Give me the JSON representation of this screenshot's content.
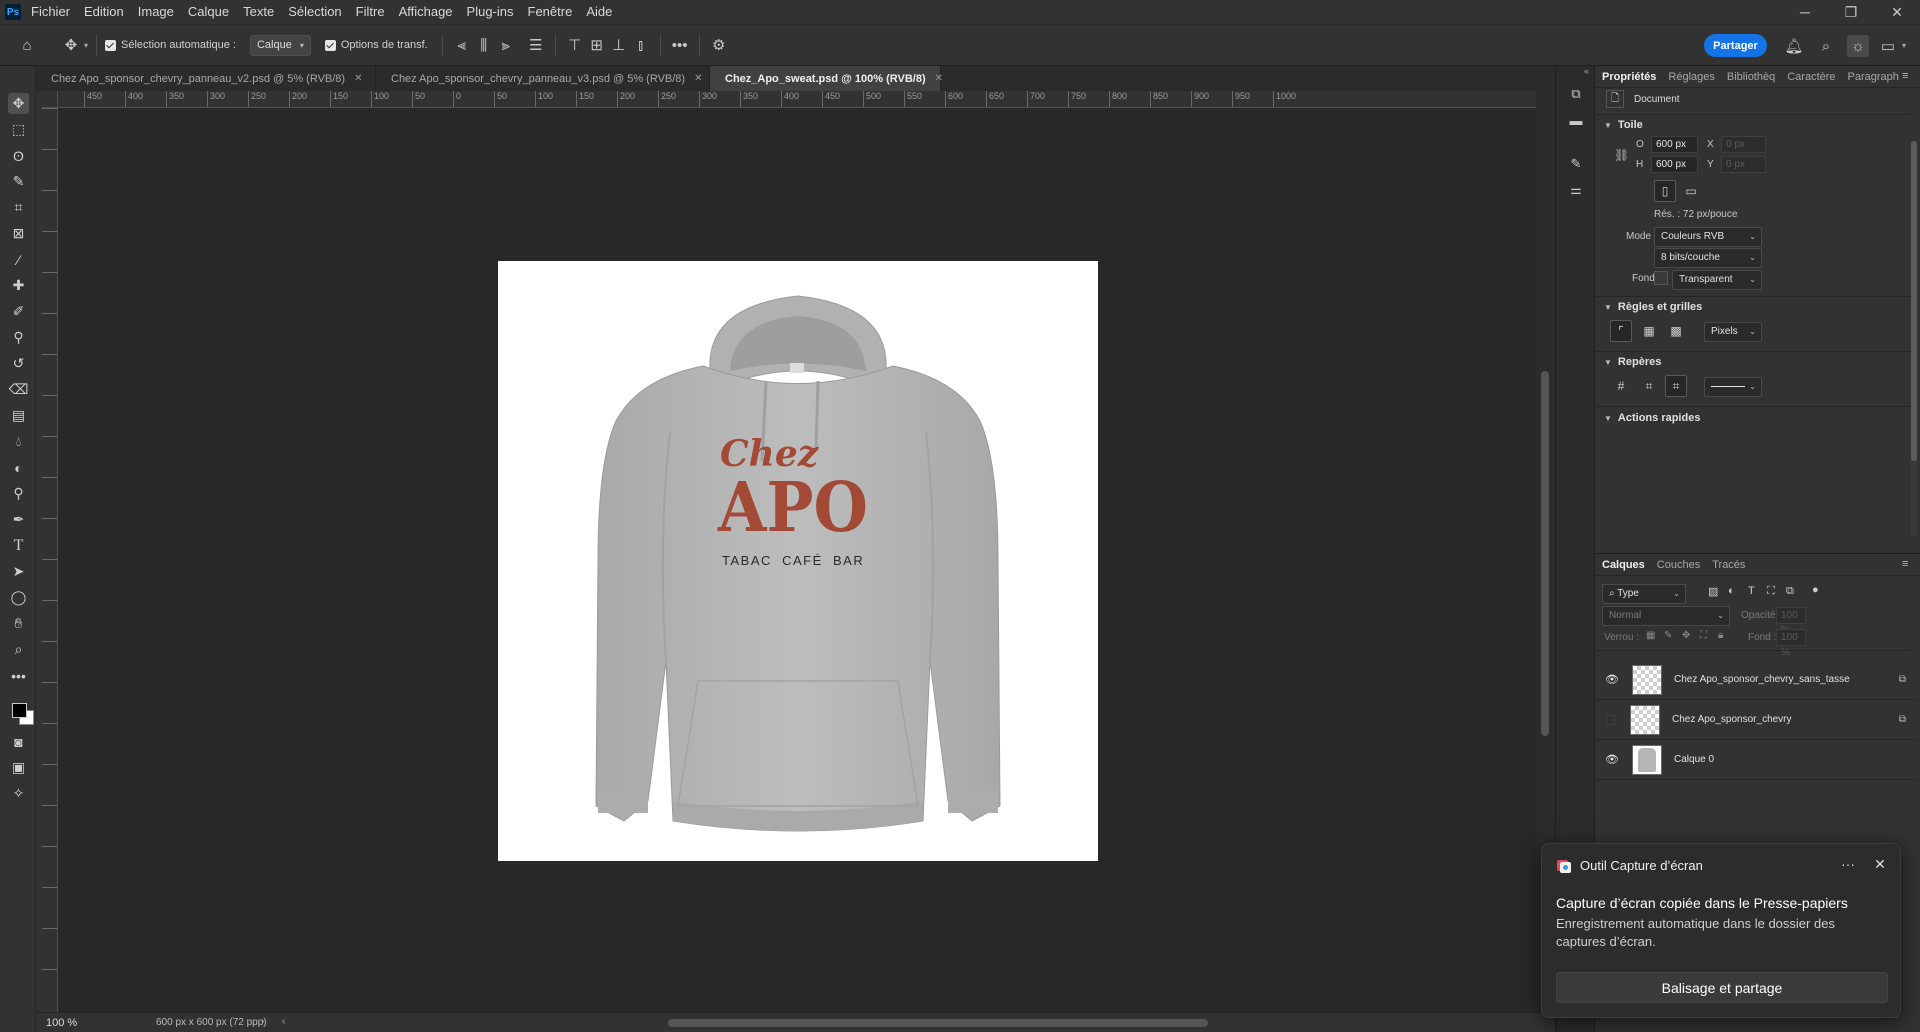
{
  "app": {
    "logo_text": "Ps"
  },
  "menubar": [
    "Fichier",
    "Edition",
    "Image",
    "Calque",
    "Texte",
    "Sélection",
    "Filtre",
    "Affichage",
    "Plug-ins",
    "Fenêtre",
    "Aide"
  ],
  "options": {
    "auto_select_label": "Sélection automatique :",
    "auto_select_value": "Calque",
    "transform_label": "Options de transf.",
    "share_label": "Partager"
  },
  "tabs": [
    {
      "label": "Chez Apo_sponsor_chevry_panneau_v2.psd @ 5% (RVB/8)",
      "active": false
    },
    {
      "label": "Chez Apo_sponsor_chevry_panneau_v3.psd @ 5% (RVB/8)",
      "active": false
    },
    {
      "label": "Chez_Apo_sweat.psd @ 100% (RVB/8)",
      "active": true
    }
  ],
  "ruler_labels": [
    "450",
    "400",
    "350",
    "300",
    "250",
    "200",
    "150",
    "100",
    "50",
    "0",
    "50",
    "100",
    "150",
    "200",
    "250",
    "300",
    "350",
    "400",
    "450",
    "500",
    "550",
    "600",
    "650",
    "700",
    "750",
    "800",
    "850",
    "900",
    "950",
    "1000"
  ],
  "artwork": {
    "line1": "Chez",
    "line2": "APO",
    "line3": "TABAC  CAFÉ  BAR",
    "hoodie_color": "#b9b9b9",
    "text_color": "#a24a36"
  },
  "status": {
    "zoom": "100 %",
    "doc_info": "600 px x 600 px (72 ppp)"
  },
  "properties": {
    "tabs": [
      "Propriétés",
      "Réglages",
      "Bibliothèq",
      "Caractère",
      "Paragraph"
    ],
    "doc_label": "Document",
    "toile": {
      "title": "Toile",
      "w_label": "O",
      "w_value": "600 px",
      "h_label": "H",
      "h_value": "600 px",
      "x_label": "X",
      "x_value": "0 px",
      "y_label": "Y",
      "y_value": "0 px",
      "resolution": "Rés. : 72 px/pouce",
      "mode_label": "Mode",
      "mode_value": "Couleurs RVB",
      "depth_value": "8 bits/couche",
      "fond_label": "Fond",
      "fond_value": "Transparent"
    },
    "rulers": {
      "title": "Règles et grilles",
      "unit": "Pixels"
    },
    "guides": {
      "title": "Repères"
    },
    "quick": {
      "title": "Actions rapides"
    }
  },
  "layers_panel": {
    "tabs": [
      "Calques",
      "Couches",
      "Tracés"
    ],
    "filter_value": "Type",
    "blend_value": "Normal",
    "opacity_label": "Opacité :",
    "opacity_value": "100 %",
    "lock_label": "Verrou :",
    "fill_label": "Fond :",
    "fill_value": "100 %",
    "layers": [
      {
        "name": "Chez Apo_sponsor_chevry_sans_tasse",
        "visible": true
      },
      {
        "name": "Chez Apo_sponsor_chevry",
        "visible": false
      },
      {
        "name": "Calque 0",
        "visible": true
      }
    ]
  },
  "toast": {
    "app": "Outil Capture d’écran",
    "title": "Capture d’écran copiée dans le Presse-papiers",
    "body": "Enregistrement automatique dans le dossier des captures d’écran.",
    "button": "Balisage et partage"
  }
}
